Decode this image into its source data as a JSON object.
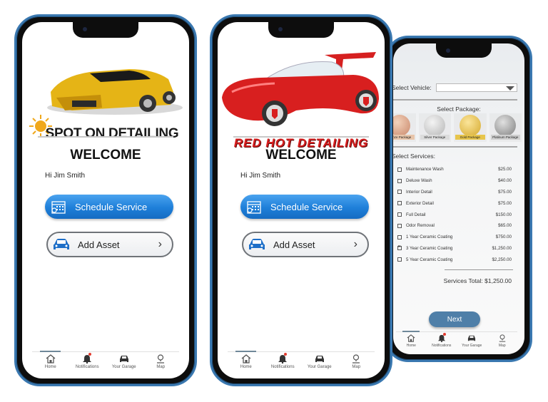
{
  "phones": [
    {
      "brand": "SPOT ON DETAILING",
      "welcome": "WELCOME",
      "greeting": "Hi Jim Smith",
      "schedule_label": "Schedule Service",
      "add_asset_label": "Add Asset",
      "accent_color": "#1e7fd9"
    },
    {
      "brand": "RED HOT DETAILING",
      "welcome": "WELCOME",
      "greeting": "Hi Jim Smith",
      "schedule_label": "Schedule Service",
      "add_asset_label": "Add Asset",
      "accent_color": "#d81f1f"
    }
  ],
  "tabbar": {
    "items": [
      {
        "label": "Home",
        "icon": "home-icon",
        "active": true
      },
      {
        "label": "Notifications",
        "icon": "bell-icon",
        "badge": true
      },
      {
        "label": "Your Garage",
        "icon": "car-icon"
      },
      {
        "label": "Map",
        "icon": "map-pin-icon"
      }
    ]
  },
  "service_screen": {
    "select_vehicle_label": "Select Vehicle:",
    "select_vehicle_value": "",
    "select_package_label": "Select Package:",
    "packages": [
      {
        "label": "Bronze Package",
        "color": "#d9a27e"
      },
      {
        "label": "Silver Package",
        "color": "#c9c9c9"
      },
      {
        "label": "Gold Package",
        "color": "#e2c14a"
      },
      {
        "label": "Platinum Package",
        "color": "#9a9a9a"
      }
    ],
    "select_services_label": "Select Services:",
    "services": [
      {
        "name": "Maintenance Wash",
        "price": "$25.00",
        "checked": false
      },
      {
        "name": "Deluxe Wash",
        "price": "$40.00",
        "checked": false
      },
      {
        "name": "Interior Detail",
        "price": "$75.00",
        "checked": false
      },
      {
        "name": "Exterior Detail",
        "price": "$75.00",
        "checked": false
      },
      {
        "name": "Full Detail",
        "price": "$150.00",
        "checked": false
      },
      {
        "name": "Odor Removal",
        "price": "$65.00",
        "checked": false
      },
      {
        "name": "1 Year Ceramic Coating",
        "price": "$750.00",
        "checked": false
      },
      {
        "name": "3 Year Ceramic Coating",
        "price": "$1,250.00",
        "checked": true
      },
      {
        "name": "5 Year Ceramic Coating",
        "price": "$2,250.00",
        "checked": false
      }
    ],
    "total_label": "Services Total:",
    "total_value": "$1,250.00",
    "next_label": "Next"
  }
}
